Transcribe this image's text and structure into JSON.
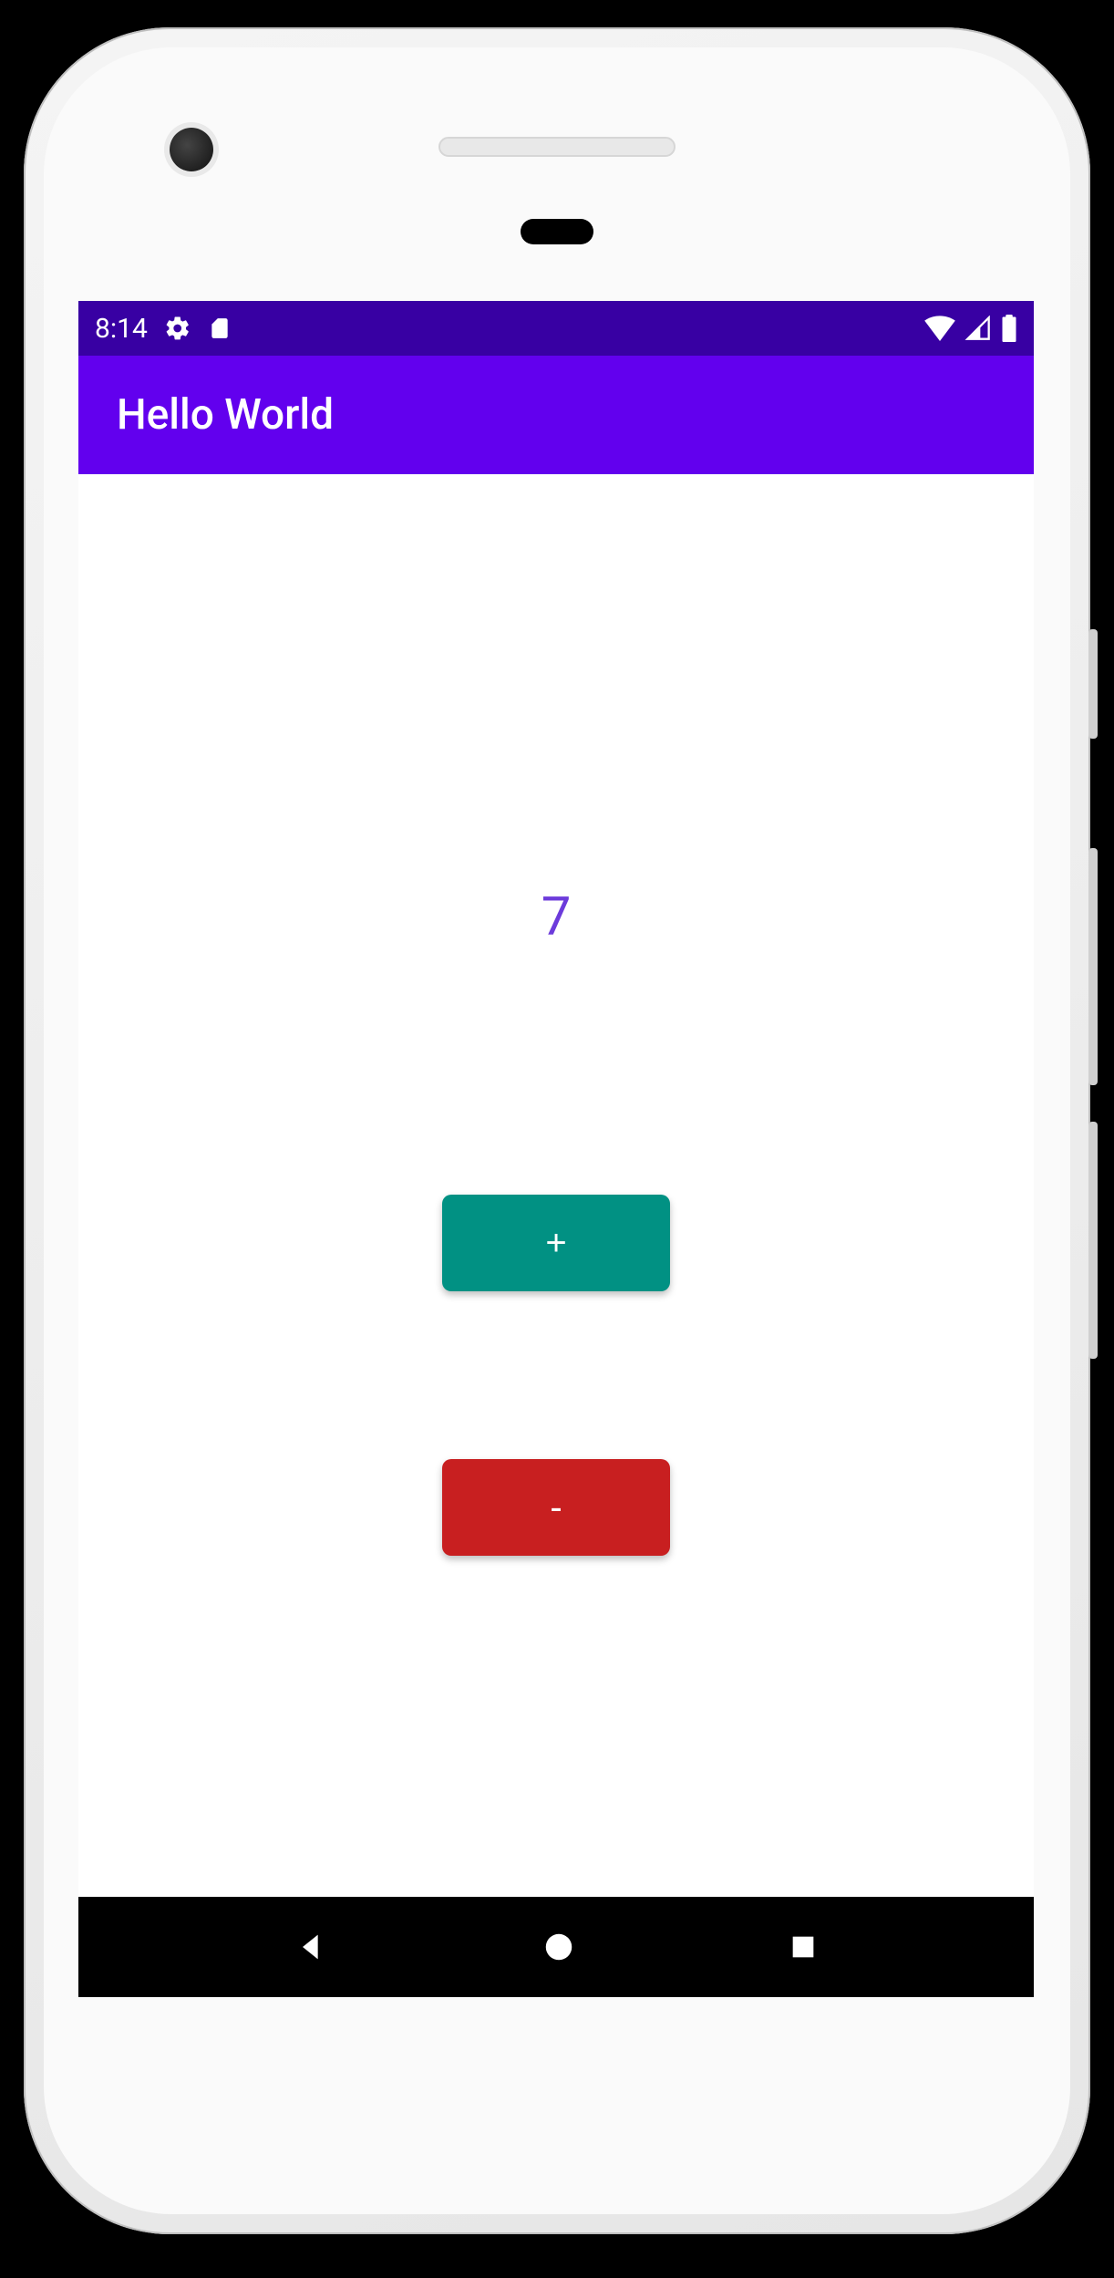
{
  "status_bar": {
    "time": "8:14",
    "icons": {
      "settings": "gear-icon",
      "sd": "sd-card-icon",
      "wifi": "wifi-icon",
      "signal": "signal-icon",
      "battery": "battery-icon"
    }
  },
  "app_bar": {
    "title": "Hello World"
  },
  "counter": {
    "value": "7",
    "color": "#6C3BDB"
  },
  "buttons": {
    "increment": {
      "label": "+",
      "color": "#019183"
    },
    "decrement": {
      "label": "-",
      "color": "#C81F20"
    }
  },
  "nav": {
    "back": "back-icon",
    "home": "home-icon",
    "recents": "recents-icon"
  },
  "colors": {
    "status_bar": "#3800a3",
    "app_bar": "#6200EE"
  }
}
